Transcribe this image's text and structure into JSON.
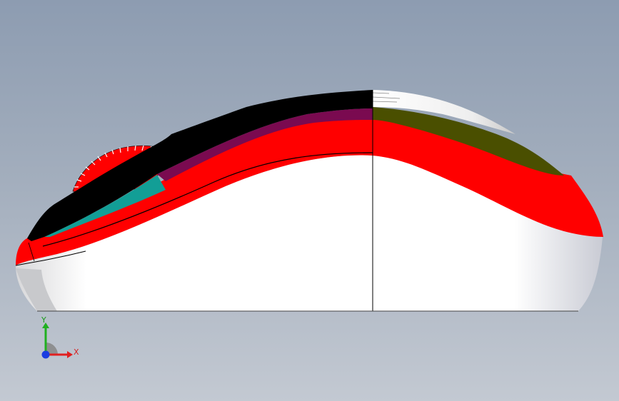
{
  "viewport": {
    "background_top": "#8d9cb1",
    "background_bottom": "#c3c9d2"
  },
  "model": {
    "name": "computer-mouse",
    "view": "side",
    "face_colors": {
      "body_white": "#ffffff",
      "band_red": "#ff0000",
      "top_black": "#000000",
      "panel_purple": "#7a0a50",
      "panel_olive": "#4a4f00",
      "panel_teal": "#129e96",
      "wheel_red": "#ff0000",
      "edge_black": "#000000"
    }
  },
  "triad": {
    "x_label": "X",
    "y_label": "Y",
    "x_color": "#e02020",
    "y_color": "#20b020",
    "z_color": "#1a3ce0"
  }
}
